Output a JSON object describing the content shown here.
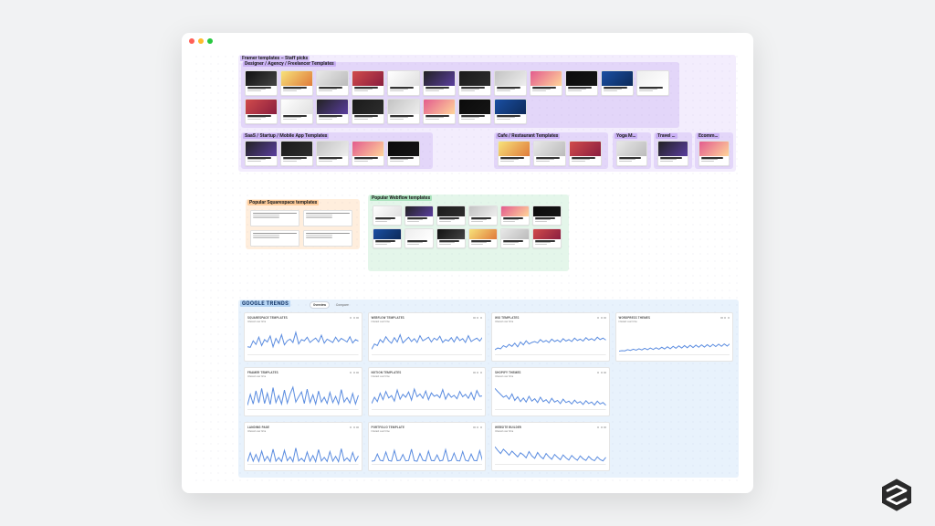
{
  "window": {
    "traffic_lights": true
  },
  "sections": {
    "framer_staff_picks": {
      "label": "Framer templates – Staff picks",
      "subgroups": [
        {
          "key": "designer",
          "label": "Designer / Agency / Freelancer Templates",
          "card_count_row1": 12,
          "card_count_row2": 8
        },
        {
          "key": "saas",
          "label": "SaaS / Startup / Mobile App Templates",
          "card_count": 5
        },
        {
          "key": "cafe",
          "label": "Cafe / Restaurant Templates",
          "card_count": 3
        },
        {
          "key": "yoga",
          "label": "Yoga M…",
          "card_count": 1
        },
        {
          "key": "travel",
          "label": "Travel …",
          "card_count": 1
        },
        {
          "key": "ecom",
          "label": "Ecomm…",
          "card_count": 1
        }
      ]
    },
    "squarespace": {
      "label": "Popular Squarespace templates",
      "card_count": 4
    },
    "webflow": {
      "label": "Popular Webflow templates",
      "card_count": 12
    },
    "google_trends": {
      "label": "GOOGLE TRENDS",
      "tabs": [
        "Overview",
        "Compare"
      ],
      "active_tab": 0,
      "panels": [
        {
          "title": "SQUARESPACE TEMPLATES",
          "subtitle": "Interest over time"
        },
        {
          "title": "WEBFLOW TEMPLATES",
          "subtitle": "Interest over time"
        },
        {
          "title": "WIX TEMPLATES",
          "subtitle": "Interest over time"
        },
        {
          "title": "WORDPRESS THEMES",
          "subtitle": "Interest over time"
        },
        {
          "title": "FRAMER TEMPLATES",
          "subtitle": "Interest over time"
        },
        {
          "title": "NOTION TEMPLATES",
          "subtitle": "Interest over time"
        },
        {
          "title": "SHOPIFY THEMES",
          "subtitle": "Interest over time"
        },
        {
          "title": "LANDING PAGE",
          "subtitle": "Interest over time"
        },
        {
          "title": "PORTFOLIO TEMPLATE",
          "subtitle": "Interest over time"
        },
        {
          "title": "WEBSITE BUILDER",
          "subtitle": "Interest over time"
        }
      ]
    }
  },
  "chart_data": [
    {
      "type": "line",
      "title": "SQUARESPACE TEMPLATES",
      "xlabel": "",
      "ylabel": "",
      "ylim": [
        0,
        100
      ],
      "x": [
        0,
        1,
        2,
        3,
        4,
        5,
        6,
        7,
        8,
        9,
        10,
        11,
        12,
        13,
        14,
        15,
        16,
        17,
        18,
        19,
        20,
        21,
        22,
        23,
        24,
        25,
        26,
        27,
        28,
        29,
        30,
        31,
        32,
        33,
        34,
        35,
        36,
        37,
        38,
        39
      ],
      "values": [
        30,
        28,
        55,
        40,
        70,
        35,
        60,
        50,
        75,
        30,
        65,
        45,
        80,
        38,
        55,
        62,
        48,
        90,
        42,
        60,
        55,
        70,
        48,
        58,
        66,
        50,
        78,
        45,
        62,
        55,
        48,
        70,
        52,
        65,
        58,
        50,
        72,
        46,
        60,
        54
      ]
    },
    {
      "type": "line",
      "title": "WEBFLOW TEMPLATES",
      "xlabel": "",
      "ylabel": "",
      "ylim": [
        0,
        100
      ],
      "x": [
        0,
        1,
        2,
        3,
        4,
        5,
        6,
        7,
        8,
        9,
        10,
        11,
        12,
        13,
        14,
        15,
        16,
        17,
        18,
        19,
        20,
        21,
        22,
        23,
        24,
        25,
        26,
        27,
        28,
        29,
        30,
        31,
        32,
        33,
        34,
        35,
        36,
        37,
        38,
        39
      ],
      "values": [
        20,
        42,
        35,
        60,
        48,
        72,
        55,
        45,
        68,
        50,
        80,
        46,
        58,
        70,
        52,
        64,
        48,
        76,
        55,
        62,
        70,
        50,
        66,
        58,
        74,
        48,
        60,
        54,
        68,
        50,
        72,
        56,
        64,
        48,
        76,
        52,
        60,
        66,
        54,
        70
      ]
    },
    {
      "type": "line",
      "title": "WIX TEMPLATES",
      "xlabel": "",
      "ylabel": "",
      "ylim": [
        0,
        100
      ],
      "x": [
        0,
        1,
        2,
        3,
        4,
        5,
        6,
        7,
        8,
        9,
        10,
        11,
        12,
        13,
        14,
        15,
        16,
        17,
        18,
        19,
        20,
        21,
        22,
        23,
        24,
        25,
        26,
        27,
        28,
        29,
        30,
        31,
        32,
        33,
        34,
        35,
        36,
        37,
        38,
        39
      ],
      "values": [
        18,
        25,
        22,
        35,
        28,
        40,
        32,
        45,
        30,
        50,
        38,
        55,
        42,
        48,
        52,
        46,
        60,
        50,
        56,
        48,
        62,
        52,
        58,
        50,
        64,
        54,
        60,
        52,
        66,
        56,
        62,
        54,
        68,
        58,
        64,
        56,
        70,
        60,
        66,
        58
      ]
    },
    {
      "type": "line",
      "title": "WORDPRESS THEMES",
      "xlabel": "",
      "ylabel": "",
      "ylim": [
        0,
        100
      ],
      "x": [
        0,
        1,
        2,
        3,
        4,
        5,
        6,
        7,
        8,
        9,
        10,
        11,
        12,
        13,
        14,
        15,
        16,
        17,
        18,
        19,
        20,
        21,
        22,
        23,
        24,
        25,
        26,
        27,
        28,
        29,
        30,
        31,
        32,
        33,
        34,
        35,
        36,
        37,
        38,
        39
      ],
      "values": [
        12,
        14,
        13,
        18,
        15,
        20,
        16,
        22,
        17,
        24,
        18,
        25,
        19,
        26,
        20,
        28,
        21,
        30,
        22,
        32,
        24,
        34,
        25,
        35,
        26,
        36,
        27,
        37,
        28,
        38,
        29,
        39,
        30,
        40,
        31,
        41,
        32,
        42,
        33,
        43
      ]
    },
    {
      "type": "line",
      "title": "FRAMER TEMPLATES",
      "xlabel": "",
      "ylabel": "",
      "ylim": [
        0,
        100
      ],
      "x": [
        0,
        1,
        2,
        3,
        4,
        5,
        6,
        7,
        8,
        9,
        10,
        11,
        12,
        13,
        14,
        15,
        16,
        17,
        18,
        19,
        20,
        21,
        22,
        23,
        24,
        25,
        26,
        27,
        28,
        29,
        30,
        31,
        32,
        33,
        34,
        35,
        36,
        37,
        38,
        39
      ],
      "values": [
        15,
        60,
        20,
        75,
        25,
        85,
        22,
        65,
        18,
        88,
        26,
        55,
        20,
        78,
        24,
        62,
        90,
        28,
        50,
        70,
        22,
        82,
        26,
        58,
        20,
        74,
        28,
        48,
        22,
        68,
        26,
        52,
        20,
        80,
        28,
        46,
        24,
        64,
        20,
        56
      ]
    },
    {
      "type": "line",
      "title": "NOTION TEMPLATES",
      "xlabel": "",
      "ylabel": "",
      "ylim": [
        0,
        100
      ],
      "x": [
        0,
        1,
        2,
        3,
        4,
        5,
        6,
        7,
        8,
        9,
        10,
        11,
        12,
        13,
        14,
        15,
        16,
        17,
        18,
        19,
        20,
        21,
        22,
        23,
        24,
        25,
        26,
        27,
        28,
        29,
        30,
        31,
        32,
        33,
        34,
        35,
        36,
        37,
        38,
        39
      ],
      "values": [
        22,
        48,
        30,
        65,
        38,
        72,
        45,
        55,
        32,
        78,
        40,
        60,
        48,
        70,
        36,
        82,
        50,
        62,
        44,
        74,
        38,
        66,
        52,
        58,
        46,
        80,
        40,
        64,
        48,
        56,
        42,
        72,
        50,
        60,
        44,
        68,
        38,
        76,
        52,
        54
      ]
    },
    {
      "type": "line",
      "title": "SHOPIFY THEMES",
      "xlabel": "",
      "ylabel": "",
      "ylim": [
        0,
        100
      ],
      "x": [
        0,
        1,
        2,
        3,
        4,
        5,
        6,
        7,
        8,
        9,
        10,
        11,
        12,
        13,
        14,
        15,
        16,
        17,
        18,
        19,
        20,
        21,
        22,
        23,
        24,
        25,
        26,
        27,
        28,
        29,
        30,
        31,
        32,
        33,
        34,
        35,
        36,
        37,
        38,
        39
      ],
      "values": [
        85,
        72,
        60,
        48,
        55,
        40,
        62,
        35,
        50,
        30,
        45,
        28,
        52,
        32,
        42,
        26,
        48,
        30,
        38,
        24,
        44,
        28,
        35,
        22,
        40,
        26,
        32,
        20,
        36,
        24,
        30,
        18,
        34,
        22,
        28,
        16,
        32,
        20,
        26,
        15
      ]
    },
    {
      "type": "line",
      "title": "LANDING PAGE",
      "xlabel": "",
      "ylabel": "",
      "ylim": [
        0,
        100
      ],
      "x": [
        0,
        1,
        2,
        3,
        4,
        5,
        6,
        7,
        8,
        9,
        10,
        11,
        12,
        13,
        14,
        15,
        16,
        17,
        18,
        19,
        20,
        21,
        22,
        23,
        24,
        25,
        26,
        27,
        28,
        29,
        30,
        31,
        32,
        33,
        34,
        35,
        36,
        37,
        38,
        39
      ],
      "values": [
        8,
        45,
        10,
        38,
        9,
        52,
        11,
        30,
        8,
        60,
        10,
        25,
        9,
        55,
        12,
        28,
        8,
        65,
        11,
        22,
        9,
        48,
        10,
        34,
        8,
        58,
        11,
        26,
        9,
        50,
        10,
        30,
        8,
        62,
        11,
        24,
        9,
        46,
        10,
        32
      ]
    },
    {
      "type": "line",
      "title": "PORTFOLIO TEMPLATE",
      "xlabel": "",
      "ylabel": "",
      "ylim": [
        0,
        100
      ],
      "x": [
        0,
        1,
        2,
        3,
        4,
        5,
        6,
        7,
        8,
        9,
        10,
        11,
        12,
        13,
        14,
        15,
        16,
        17,
        18,
        19,
        20,
        21,
        22,
        23,
        24,
        25,
        26,
        27,
        28,
        29,
        30,
        31,
        32,
        33,
        34,
        35,
        36,
        37,
        38,
        39
      ],
      "values": [
        10,
        12,
        40,
        14,
        11,
        48,
        13,
        10,
        55,
        12,
        14,
        38,
        11,
        13,
        60,
        12,
        10,
        42,
        14,
        11,
        52,
        13,
        12,
        36,
        11,
        14,
        58,
        10,
        13,
        44,
        12,
        11,
        50,
        14,
        10,
        40,
        13,
        12,
        54,
        11
      ]
    },
    {
      "type": "line",
      "title": "WEBSITE BUILDER",
      "xlabel": "",
      "ylabel": "",
      "ylim": [
        0,
        100
      ],
      "x": [
        0,
        1,
        2,
        3,
        4,
        5,
        6,
        7,
        8,
        9,
        10,
        11,
        12,
        13,
        14,
        15,
        16,
        17,
        18,
        19,
        20,
        21,
        22,
        23,
        24,
        25,
        26,
        27,
        28,
        29,
        30,
        31,
        32,
        33,
        34,
        35,
        36,
        37,
        38,
        39
      ],
      "values": [
        70,
        55,
        42,
        60,
        48,
        35,
        52,
        40,
        28,
        45,
        36,
        24,
        50,
        32,
        22,
        46,
        30,
        20,
        42,
        28,
        18,
        38,
        26,
        16,
        36,
        24,
        15,
        34,
        22,
        14,
        32,
        20,
        13,
        30,
        18,
        12,
        28,
        17,
        11,
        26
      ]
    }
  ]
}
